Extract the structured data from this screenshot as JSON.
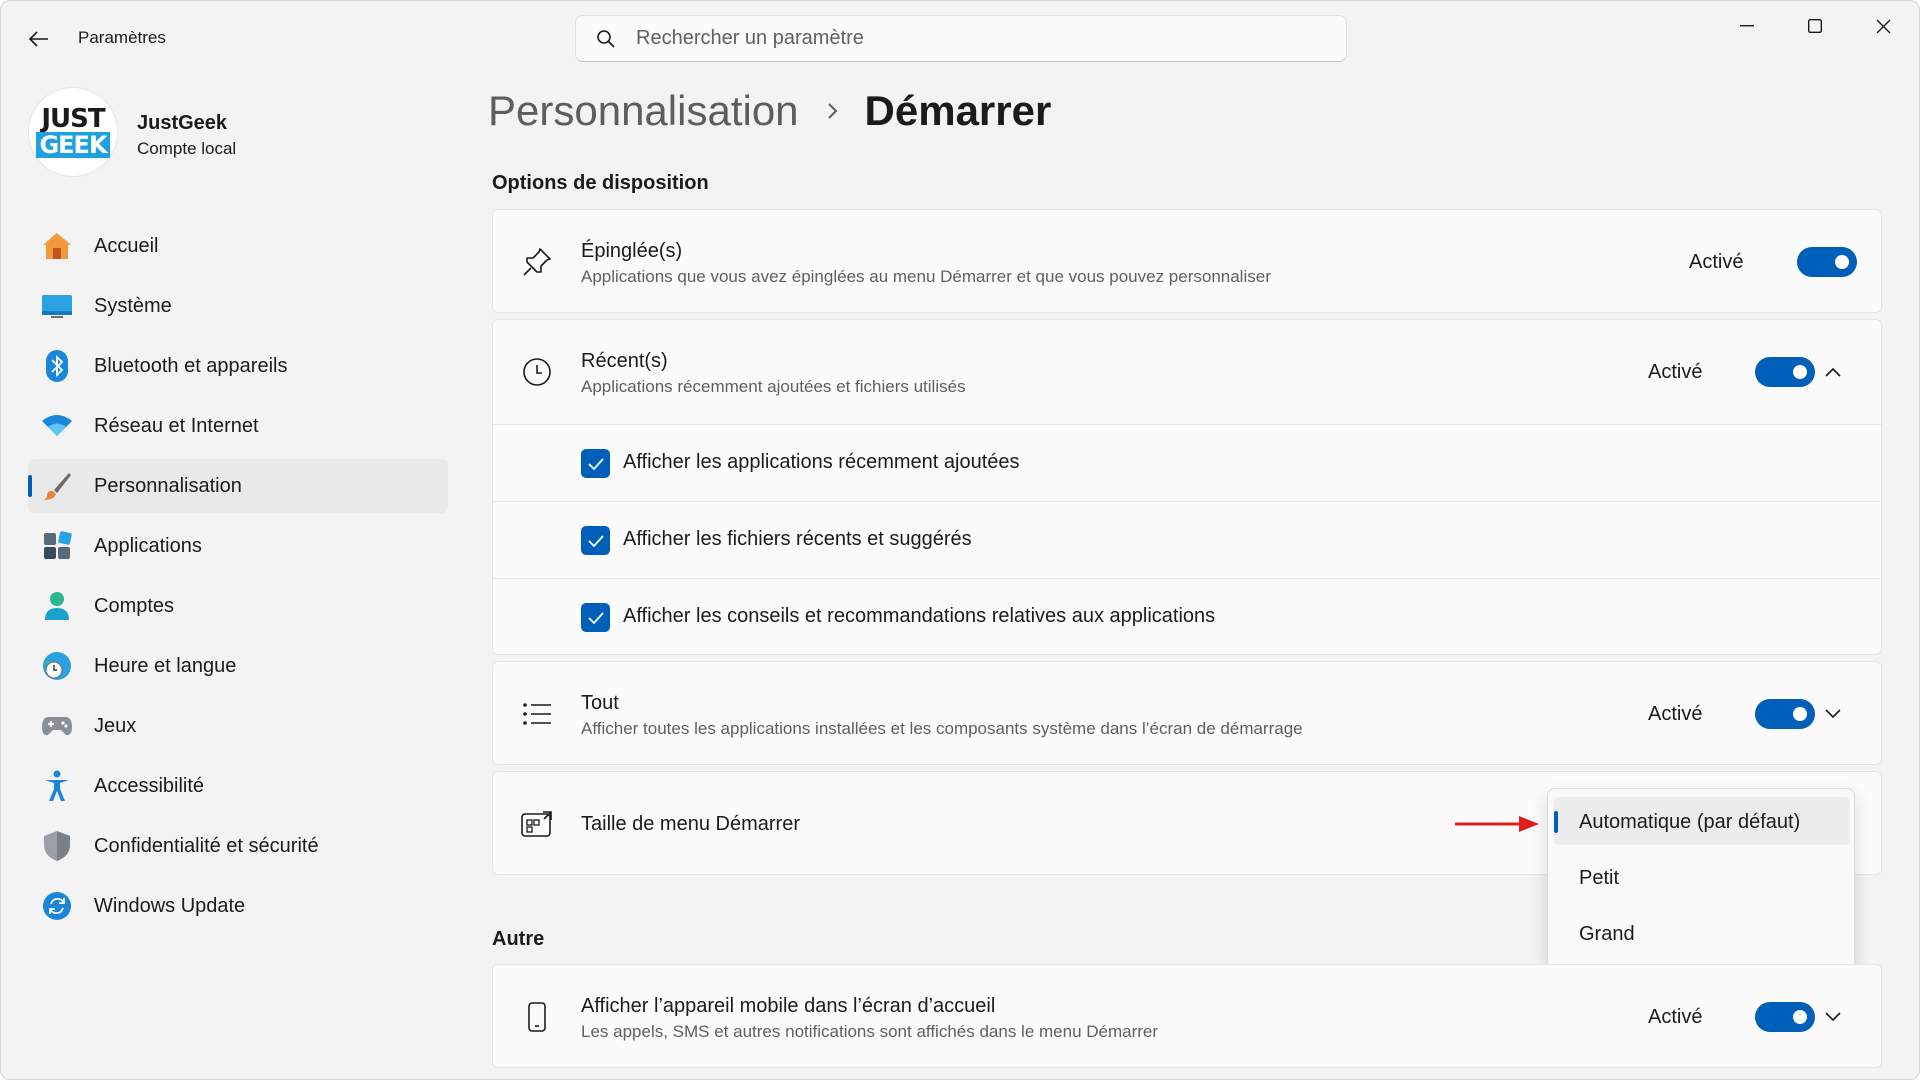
{
  "titlebar": {
    "app_title": "Paramètres",
    "search_placeholder": "Rechercher un paramètre"
  },
  "profile": {
    "logo_line1": "JUST",
    "logo_line2": "GEEK",
    "name": "JustGeek",
    "account_type": "Compte local"
  },
  "sidebar": {
    "items": [
      {
        "label": "Accueil",
        "icon": "home-icon"
      },
      {
        "label": "Système",
        "icon": "system-icon"
      },
      {
        "label": "Bluetooth et appareils",
        "icon": "bluetooth-icon"
      },
      {
        "label": "Réseau et Internet",
        "icon": "wifi-icon"
      },
      {
        "label": "Personnalisation",
        "icon": "brush-icon",
        "active": true
      },
      {
        "label": "Applications",
        "icon": "apps-icon"
      },
      {
        "label": "Comptes",
        "icon": "account-icon"
      },
      {
        "label": "Heure et langue",
        "icon": "globe-clock-icon"
      },
      {
        "label": "Jeux",
        "icon": "gamepad-icon"
      },
      {
        "label": "Accessibilité",
        "icon": "accessibility-icon"
      },
      {
        "label": "Confidentialité et sécurité",
        "icon": "shield-icon"
      },
      {
        "label": "Windows Update",
        "icon": "update-icon"
      }
    ]
  },
  "breadcrumb": {
    "parent": "Personnalisation",
    "current": "Démarrer"
  },
  "layout_section": {
    "title": "Options de disposition",
    "pinned": {
      "title": "Épinglée(s)",
      "subtitle": "Applications que vous avez épinglées au menu Démarrer et que vous pouvez personnaliser",
      "state": "Activé",
      "on": true
    },
    "recent": {
      "title": "Récent(s)",
      "subtitle": "Applications récemment ajoutées et fichiers utilisés",
      "state": "Activé",
      "on": true,
      "options": [
        {
          "label": "Afficher les applications récemment ajoutées",
          "checked": true
        },
        {
          "label": "Afficher les fichiers récents et suggérés",
          "checked": true
        },
        {
          "label": "Afficher les conseils et recommandations relatives aux applications",
          "checked": true
        }
      ]
    },
    "all": {
      "title": "Tout",
      "subtitle": "Afficher toutes les applications installées et les composants système dans l’écran de démarrage",
      "state": "Activé",
      "on": true
    },
    "size": {
      "title": "Taille de menu Démarrer",
      "options": [
        "Automatique (par défaut)",
        "Petit",
        "Grand"
      ],
      "selected": "Automatique (par défaut)"
    }
  },
  "other_section": {
    "title": "Autre",
    "mobile": {
      "title": "Afficher l’appareil mobile dans l’écran d’accueil",
      "subtitle": "Les appels, SMS et autres notifications sont affichés dans le menu Démarrer",
      "state": "Activé",
      "on": true
    }
  },
  "colors": {
    "accent": "#005fb8",
    "arrow": "#e02020"
  }
}
